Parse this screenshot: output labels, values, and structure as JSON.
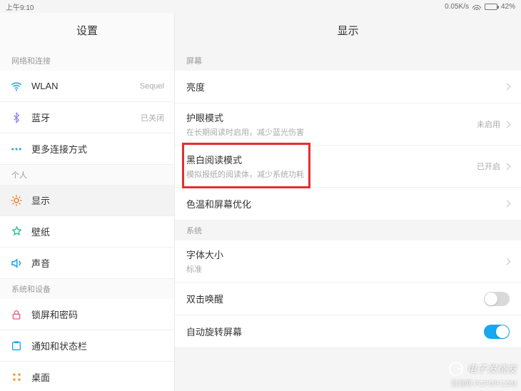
{
  "statusbar": {
    "time": "上午9:10",
    "speed": "0.05K/s",
    "battery_pct": "42%"
  },
  "sidebar": {
    "title": "设置",
    "sections": [
      {
        "label": "网络和连接",
        "items": [
          {
            "name": "wlan",
            "icon": "wifi-icon",
            "label": "WLAN",
            "value": "Sequel",
            "color": "#1aa3e8"
          },
          {
            "name": "bluetooth",
            "icon": "bluetooth-icon",
            "label": "蓝牙",
            "value": "已关闭",
            "color": "#9b7fe6"
          },
          {
            "name": "more-conn",
            "icon": "dots-icon",
            "label": "更多连接方式",
            "value": "",
            "color": "#1aa3e8"
          }
        ]
      },
      {
        "label": "个人",
        "items": [
          {
            "name": "display",
            "icon": "display-icon",
            "label": "显示",
            "value": "",
            "color": "#f07b2a",
            "active": true
          },
          {
            "name": "wallpaper",
            "icon": "wallpaper-icon",
            "label": "壁纸",
            "value": "",
            "color": "#2fc08b"
          },
          {
            "name": "sound",
            "icon": "sound-icon",
            "label": "声音",
            "value": "",
            "color": "#1aa3e8"
          }
        ]
      },
      {
        "label": "系统和设备",
        "items": [
          {
            "name": "lock",
            "icon": "lock-icon",
            "label": "锁屏和密码",
            "value": "",
            "color": "#e85a7b"
          },
          {
            "name": "notif",
            "icon": "notif-icon",
            "label": "通知和状态栏",
            "value": "",
            "color": "#1aa3e8"
          },
          {
            "name": "desktop",
            "icon": "home-icon",
            "label": "桌面",
            "value": "",
            "color": "#f0a02a"
          }
        ]
      }
    ]
  },
  "panel": {
    "title": "显示",
    "groups": [
      {
        "label": "屏幕",
        "rows": [
          {
            "name": "brightness",
            "title": "亮度",
            "subtitle": "",
            "state": "",
            "action": "chevron"
          },
          {
            "name": "eye-mode",
            "title": "护眼模式",
            "subtitle": "在长期阅读时启用，减少蓝光伤害",
            "state": "未启用",
            "action": "chevron"
          },
          {
            "name": "bw-mode",
            "title": "黑白阅读模式",
            "subtitle": "模拟报纸的阅读体，减少系统功耗",
            "state": "已开启",
            "action": "chevron",
            "highlighted": true
          },
          {
            "name": "color-opt",
            "title": "色温和屏幕优化",
            "subtitle": "",
            "state": "",
            "action": "chevron"
          }
        ]
      },
      {
        "label": "系统",
        "rows": [
          {
            "name": "font-size",
            "title": "字体大小",
            "subtitle": "标准",
            "state": "",
            "action": "chevron"
          },
          {
            "name": "double-tap",
            "title": "双击唤醒",
            "subtitle": "",
            "state": "",
            "action": "toggle",
            "on": false
          },
          {
            "name": "auto-rotate",
            "title": "自动旋转屏幕",
            "subtitle": "",
            "state": "",
            "action": "toggle",
            "on": true
          }
        ]
      }
    ]
  },
  "watermark": {
    "line1": "电子发烧友",
    "line2": "泡泡网 PCPOP.COM"
  }
}
